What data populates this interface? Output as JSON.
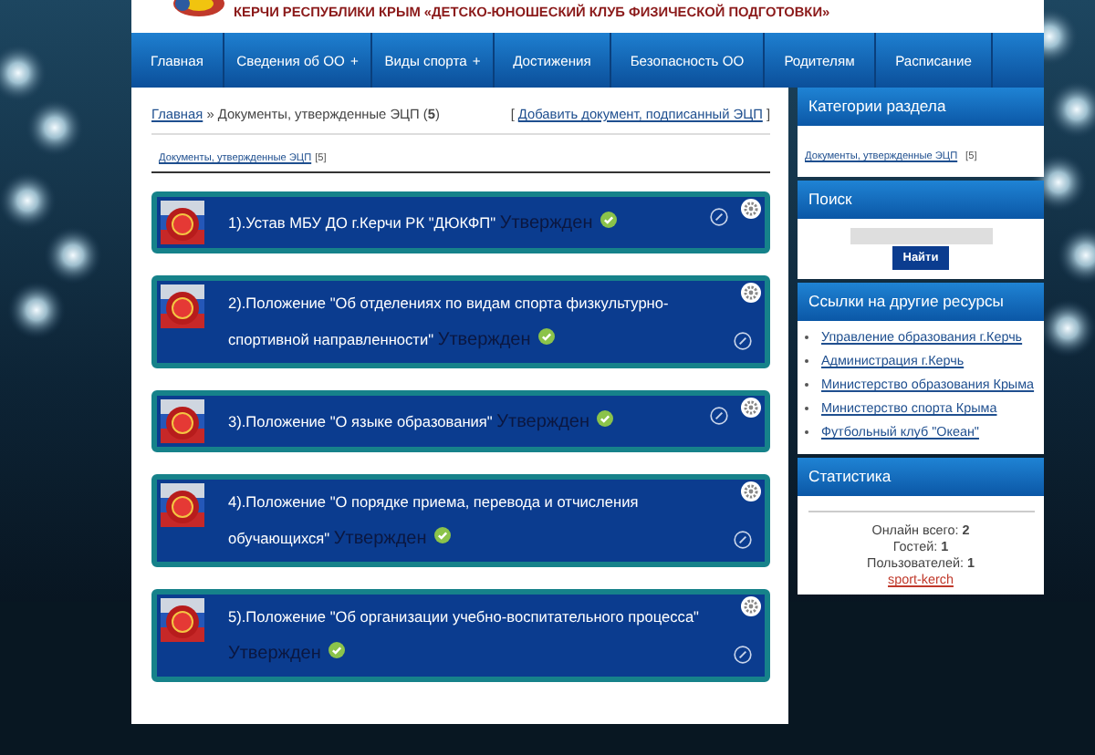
{
  "header": {
    "title": "КЕРЧИ РЕСПУБЛИКИ КРЫМ «ДЕТСКО-ЮНОШЕСКИЙ КЛУБ ФИЗИЧЕСКОЙ ПОДГОТОВКИ»"
  },
  "nav": [
    {
      "label": "Главная"
    },
    {
      "label": "Сведения об ОО",
      "mark": "+"
    },
    {
      "label": "Виды спорта",
      "mark": "+"
    },
    {
      "label": "Достижения"
    },
    {
      "label": "Безопасность ОО"
    },
    {
      "label": "Родителям"
    },
    {
      "label": "Расписание"
    }
  ],
  "breadcrumb": {
    "home": "Главная",
    "separator": "»",
    "current": "Документы, утвержденные ЭЦП",
    "count": "(**5**)"
  },
  "action_link": {
    "open": "[",
    "label": "Добавить документ, подписанный ЭЦП",
    "close": "]"
  },
  "category_tab": {
    "label": "Документы, утвержденные ЭЦП",
    "count": "[5]"
  },
  "documents": [
    {
      "title": "1).Устав МБУ ДО г.Керчи РК \"ДЮКФП\"",
      "status": "Утвержден",
      "approved": true
    },
    {
      "title": "2).Положение \"Об отделениях по видам спорта физкультурно-спортивной направленности\"",
      "status": "Утвержден",
      "approved": true
    },
    {
      "title": "3).Положение \"О языке образования\"",
      "status": "Утвержден",
      "approved": true
    },
    {
      "title": "4).Положение \"О порядке приема, перевода и отчисления обучающихся\"",
      "status": "Утвержден",
      "approved": true
    },
    {
      "title": "5).Положение \"Об организации учебно-воспитательного процесса\"",
      "status": "Утвержден",
      "approved": true
    }
  ],
  "sidebar": {
    "categories": {
      "title": "Категории раздела",
      "items": [
        {
          "label": "Документы, утвержденные ЭЦП",
          "count": "[5]"
        }
      ]
    },
    "search": {
      "title": "Поиск",
      "button": "Найти"
    },
    "links": {
      "title": "Ссылки на другие ресурсы",
      "items": [
        "Управление образования г.Керчь",
        "Администрация г.Керчь",
        "Министерство образования Крыма",
        "Министерство спорта Крыма",
        "Футбольный клуб \"Океан\""
      ]
    },
    "stats": {
      "title": "Статистика",
      "rows": [
        {
          "label": "Онлайн всего:",
          "value": "2"
        },
        {
          "label": "Гостей:",
          "value": "1"
        },
        {
          "label": "Пользователей:",
          "value": "1"
        }
      ],
      "user": "sport-kerch"
    }
  }
}
